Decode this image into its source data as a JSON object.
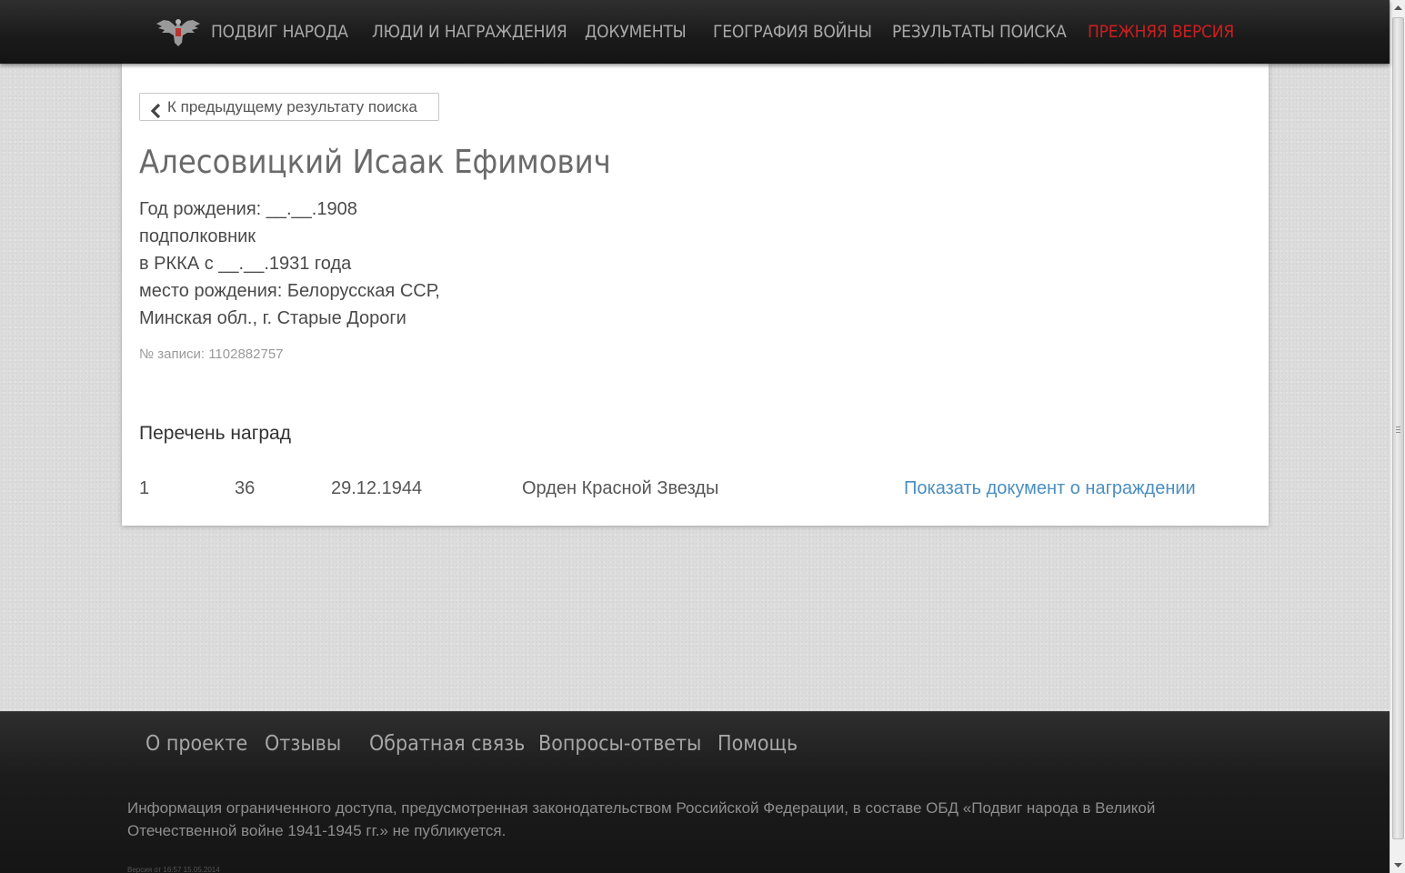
{
  "nav": {
    "items": [
      {
        "label": "Подвиг народа"
      },
      {
        "label": "Люди и награждения"
      },
      {
        "label": "Документы"
      },
      {
        "label": "География войны"
      },
      {
        "label": "Результаты поиска"
      },
      {
        "label": "Прежняя версия"
      }
    ],
    "logo_icon": "double-headed-eagle-emblem-icon",
    "legacy_color": "#cc1f1f"
  },
  "card": {
    "back_label": "К предыдущему результату поиска",
    "back_icon": "chevron-left-icon",
    "name": "Алесовицкий Исаак Ефимович",
    "details": [
      "Год рождения: __.__.1908",
      "подполковник",
      "в РККА с __.__.1931 года",
      "место рождения: Белорусская ССР,",
      "Минская обл., г. Старые Дороги"
    ],
    "record_no": "№ записи: 1102882757",
    "awards_title": "Перечень наград",
    "awards": [
      {
        "num": "1",
        "id": "36",
        "date": "29.12.1944",
        "name": "Орден Красной Звезды",
        "link": "Показать документ о награждении"
      }
    ],
    "link_color": "#4a8fbf"
  },
  "footer": {
    "links": [
      {
        "label": "О проекте"
      },
      {
        "label": "Отзывы"
      },
      {
        "label": "Обратная связь"
      },
      {
        "label": "Вопросы-ответы"
      },
      {
        "label": "Помощь"
      }
    ],
    "disclaimer": "Информация ограниченного доступа, предусмотренная законодательством Российской Федерации, в составе ОБД «Подвиг народа в Великой Отечественной войне 1941-1945 гг.» не публикуется.",
    "version": "Версия от 16:57 15.05.2014"
  }
}
